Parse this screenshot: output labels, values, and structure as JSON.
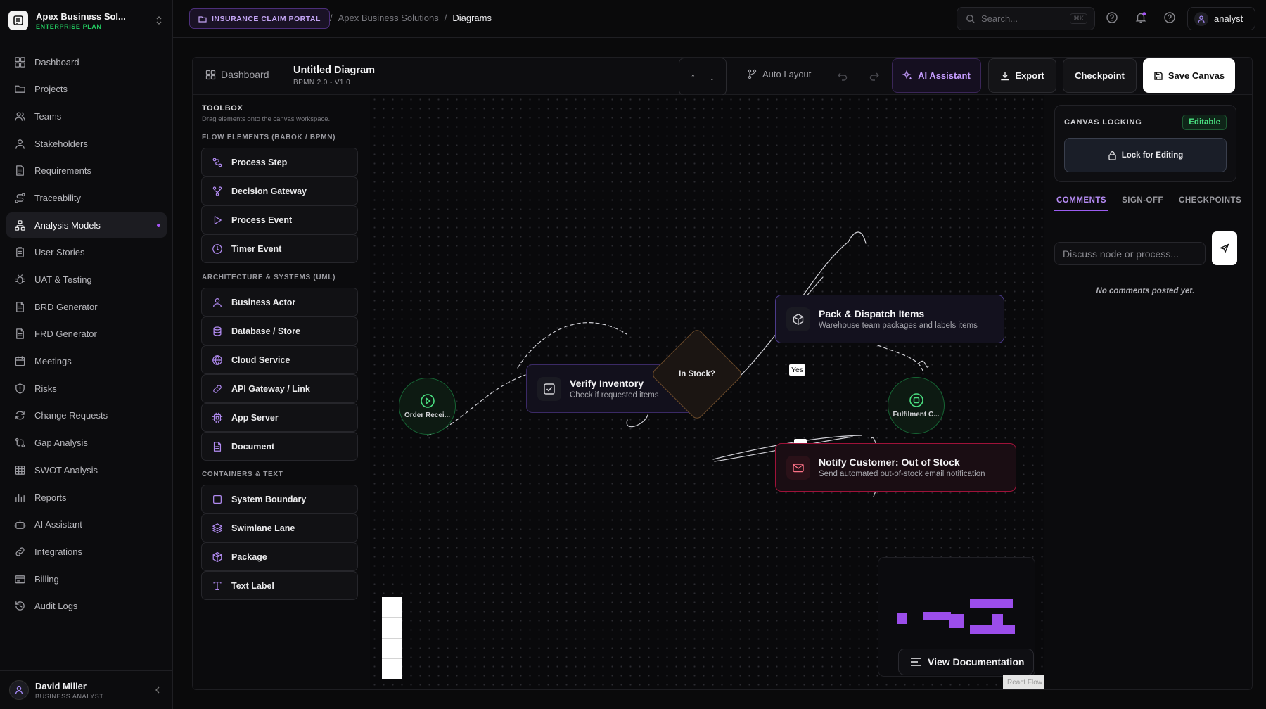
{
  "org": {
    "name": "Apex Business Sol...",
    "plan": "ENTERPRISE PLAN"
  },
  "nav": [
    {
      "label": "Dashboard",
      "icon": "grid-icon"
    },
    {
      "label": "Projects",
      "icon": "folder-icon"
    },
    {
      "label": "Teams",
      "icon": "users-icon"
    },
    {
      "label": "Stakeholders",
      "icon": "user-icon"
    },
    {
      "label": "Requirements",
      "icon": "file-text-icon"
    },
    {
      "label": "Traceability",
      "icon": "route-icon"
    },
    {
      "label": "Analysis Models",
      "icon": "network-icon",
      "active": true
    },
    {
      "label": "User Stories",
      "icon": "clipboard-icon"
    },
    {
      "label": "UAT & Testing",
      "icon": "bug-icon"
    },
    {
      "label": "BRD Generator",
      "icon": "doc-icon"
    },
    {
      "label": "FRD Generator",
      "icon": "doc-icon"
    },
    {
      "label": "Meetings",
      "icon": "calendar-icon"
    },
    {
      "label": "Risks",
      "icon": "shield-alert-icon"
    },
    {
      "label": "Change Requests",
      "icon": "refresh-icon"
    },
    {
      "label": "Gap Analysis",
      "icon": "git-compare-icon"
    },
    {
      "label": "SWOT Analysis",
      "icon": "table-icon"
    },
    {
      "label": "Reports",
      "icon": "bar-chart-icon"
    },
    {
      "label": "AI Assistant",
      "icon": "bot-icon"
    },
    {
      "label": "Integrations",
      "icon": "link-icon"
    },
    {
      "label": "Billing",
      "icon": "credit-card-icon"
    },
    {
      "label": "Audit Logs",
      "icon": "history-icon"
    }
  ],
  "user": {
    "name": "David Miller",
    "role": "BUSINESS ANALYST"
  },
  "topbar": {
    "portal": "INSURANCE CLAIM PORTAL",
    "crumb_org": "Apex Business Solutions",
    "crumb_page": "Diagrams",
    "search_placeholder": "Search...",
    "search_kbd": "⌘K",
    "username": "analyst"
  },
  "editor": {
    "dashboard_label": "Dashboard",
    "title": "Untitled Diagram",
    "version": "BPMN 2.0 - V1.0",
    "arrow_up": "↑",
    "arrow_down": "↓",
    "auto_layout": "Auto Layout",
    "ai_assistant": "AI Assistant",
    "export": "Export",
    "checkpoint": "Checkpoint",
    "save": "Save Canvas"
  },
  "toolbox": {
    "title": "TOOLBOX",
    "subtitle": "Drag elements onto the canvas workspace.",
    "sections": [
      {
        "title": "FLOW ELEMENTS (BABOK / BPMN)",
        "items": [
          {
            "label": "Process Step",
            "icon": "process-step-icon"
          },
          {
            "label": "Decision Gateway",
            "icon": "git-branch-icon"
          },
          {
            "label": "Process Event",
            "icon": "play-icon"
          },
          {
            "label": "Timer Event",
            "icon": "clock-icon"
          }
        ]
      },
      {
        "title": "ARCHITECTURE & SYSTEMS (UML)",
        "items": [
          {
            "label": "Business Actor",
            "icon": "user-icon"
          },
          {
            "label": "Database / Store",
            "icon": "database-icon"
          },
          {
            "label": "Cloud Service",
            "icon": "globe-icon"
          },
          {
            "label": "API Gateway / Link",
            "icon": "link-icon"
          },
          {
            "label": "App Server",
            "icon": "cpu-icon"
          },
          {
            "label": "Document",
            "icon": "file-icon"
          }
        ]
      },
      {
        "title": "CONTAINERS & TEXT",
        "items": [
          {
            "label": "System Boundary",
            "icon": "square-icon"
          },
          {
            "label": "Swimlane Lane",
            "icon": "layers-icon"
          },
          {
            "label": "Package",
            "icon": "package-icon"
          },
          {
            "label": "Text Label",
            "icon": "type-icon"
          }
        ]
      }
    ]
  },
  "canvas": {
    "nodes": {
      "order": {
        "label": "Order Recei..."
      },
      "verify": {
        "title": "Verify Inventory",
        "subtitle": "Check if requested items"
      },
      "decision": {
        "label": "In Stock?"
      },
      "pack": {
        "title": "Pack & Dispatch Items",
        "subtitle": "Warehouse team packages and labels items"
      },
      "fulfil": {
        "label": "Fulfilment C..."
      },
      "notify": {
        "title": "Notify Customer: Out of Stock",
        "subtitle": "Send automated out-of-stock email notification"
      }
    },
    "edge_yes": "Yes",
    "view_doc": "View Documentation",
    "attribution": "React Flow"
  },
  "right_panel": {
    "lock_title": "CANVAS LOCKING",
    "status": "Editable",
    "lock_button": "Lock for Editing",
    "tabs": [
      "COMMENTS",
      "SIGN-OFF",
      "CHECKPOINTS"
    ],
    "comment_placeholder": "Discuss node or process...",
    "empty": "No comments posted yet."
  },
  "colors": {
    "accent": "#a855f7",
    "success": "#22c55e",
    "danger": "#e11d48",
    "warning": "#b45309"
  }
}
